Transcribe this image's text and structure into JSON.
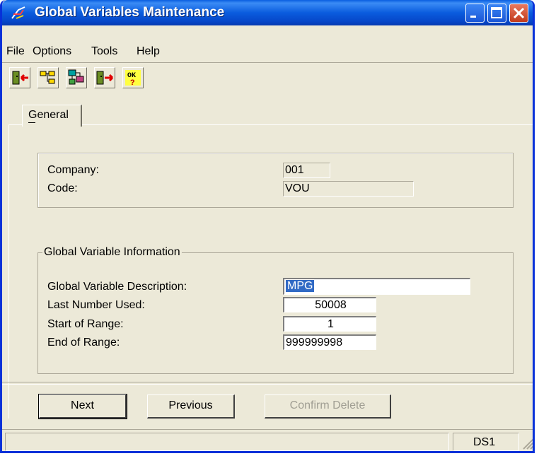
{
  "window": {
    "title": "Global Variables Maintenance",
    "accent": "#0a5cde",
    "close_color": "#c23a1b"
  },
  "menu": {
    "items": [
      {
        "label": "File"
      },
      {
        "label": "Options"
      },
      {
        "label": "Tools"
      },
      {
        "label": "Help"
      }
    ]
  },
  "toolbar": {
    "icons": [
      "exit-door-icon",
      "tree-hierarchy-icon",
      "computer-tree-icon",
      "enter-door-icon",
      "ok-help-icon"
    ]
  },
  "tabs": {
    "general": "General"
  },
  "record": {
    "company_label": "Company:",
    "company_value": "001",
    "code_label": "Code:",
    "code_value": "VOU"
  },
  "global_info": {
    "title": "Global Variable Information",
    "description_label": "Global Variable Description:",
    "description_value": "MPG",
    "last_number_label": "Last Number Used:",
    "last_number_value": "50008",
    "start_range_label": "Start of Range:",
    "start_range_value": "1",
    "end_range_label": "End of Range:",
    "end_range_value": "999999998"
  },
  "buttons": {
    "next": "Next",
    "previous": "Previous",
    "confirm_delete": "Confirm Delete"
  },
  "status": {
    "db": "DS1"
  }
}
